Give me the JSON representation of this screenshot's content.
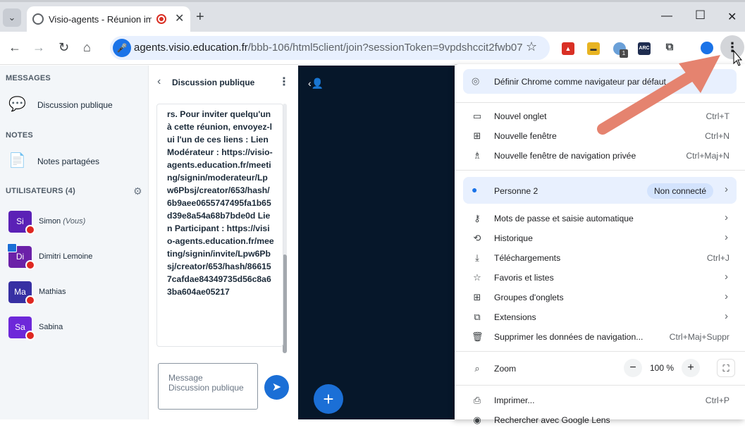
{
  "browser": {
    "tab_title": "Visio-agents - Réunion imp",
    "url_domain": "agents.visio.education.fr",
    "url_path": "/bbb-106/html5client/join?sessionToken=9vpdshccit2fwb07",
    "extension_badge": "1",
    "ext_arc": "ARC"
  },
  "sidebar": {
    "messages_title": "MESSAGES",
    "public_chat": "Discussion publique",
    "notes_title": "NOTES",
    "shared_notes": "Notes partagées",
    "users_title": "UTILISATEURS (4)",
    "users": [
      {
        "initials": "Si",
        "name": "Simon",
        "suffix": "(Vous)",
        "color": "#5b21b6"
      },
      {
        "initials": "Di",
        "name": "Dimitri Lemoine",
        "suffix": "",
        "color": "#6b21a8"
      },
      {
        "initials": "Ma",
        "name": "Mathias",
        "suffix": "",
        "color": "#3730a3"
      },
      {
        "initials": "Sa",
        "name": "Sabina",
        "suffix": "",
        "color": "#6d28d9"
      }
    ]
  },
  "chat": {
    "title": "Discussion publique",
    "message": "Bienvenue aux modérateurs. Pour inviter quelqu'un à cette réunion, envoyez-lui l'un de ces liens : Lien Modérateur : https://visio-agents.education.fr/meeting/signin/moderateur/Lpw6Pbsj/creator/653/hash/6b9aee0655747495fa1b65d39e8a54a68b7bde0d Lien Participant : https://visio-agents.education.fr/meeting/signin/invite/Lpw6Pbsj/creator/653/hash/866157cafdae84349735d56c8a63ba604ae05217",
    "input_placeholder": "Message Discussion publique"
  },
  "menu": {
    "default_banner": "Définir Chrome comme navigateur par défaut",
    "items_group1": [
      {
        "label": "Nouvel onglet",
        "shortcut": "Ctrl+T",
        "icon": "new-tab-icon"
      },
      {
        "label": "Nouvelle fenêtre",
        "shortcut": "Ctrl+N",
        "icon": "new-window-icon"
      },
      {
        "label": "Nouvelle fenêtre de navigation privée",
        "shortcut": "Ctrl+Maj+N",
        "icon": "incognito-icon"
      }
    ],
    "profile": {
      "name": "Personne 2",
      "status": "Non connecté"
    },
    "items_group2": [
      {
        "label": "Mots de passe et saisie automatique",
        "shortcut": "",
        "icon": "key-icon"
      },
      {
        "label": "Historique",
        "shortcut": "",
        "icon": "history-icon"
      },
      {
        "label": "Téléchargements",
        "shortcut": "Ctrl+J",
        "icon": "download-icon"
      },
      {
        "label": "Favoris et listes",
        "shortcut": "",
        "icon": "star-icon"
      },
      {
        "label": "Groupes d'onglets",
        "shortcut": "",
        "icon": "grid-icon"
      },
      {
        "label": "Extensions",
        "shortcut": "",
        "icon": "puzzle-icon"
      },
      {
        "label": "Supprimer les données de navigation...",
        "shortcut": "Ctrl+Maj+Suppr",
        "icon": "trash-icon"
      }
    ],
    "zoom_label": "Zoom",
    "zoom_value": "100 %",
    "print_label": "Imprimer...",
    "print_shortcut": "Ctrl+P",
    "lens_label": "Rechercher avec Google Lens"
  }
}
